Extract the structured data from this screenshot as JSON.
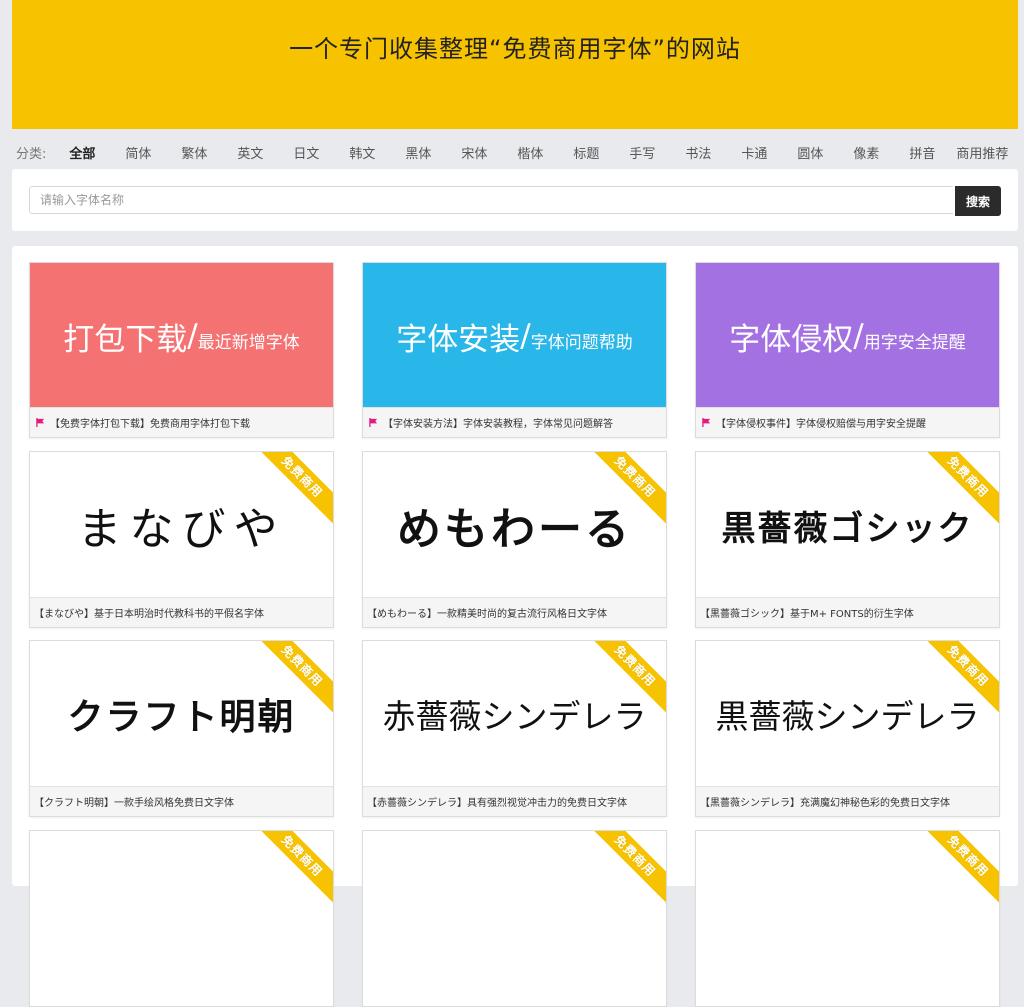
{
  "header": {
    "title": "一个专门收集整理“免费商用字体”的网站"
  },
  "categories": {
    "label": "分类:",
    "items": [
      "全部",
      "简体",
      "繁体",
      "英文",
      "日文",
      "韩文",
      "黑体",
      "宋体",
      "楷体",
      "标题",
      "手写",
      "书法",
      "卡通",
      "圆体",
      "像素",
      "拼音",
      "商用推荐"
    ]
  },
  "search": {
    "placeholder": "请输入字体名称",
    "button": "搜索"
  },
  "colors": {
    "banner": "#f7c200",
    "download": "#f57273",
    "install": "#29b6e8",
    "rights": "#a371e2",
    "flag": "#e5197f"
  },
  "features": [
    {
      "big": "打包下载",
      "slash": "/",
      "small": "最近新增字体",
      "caption": "【免费字体打包下载】免费商用字体打包下载",
      "icon": "flag-icon"
    },
    {
      "big": "字体安装",
      "slash": "/",
      "small": "字体问题帮助",
      "caption": "【字体安装方法】字体安装教程，字体常见问题解答",
      "icon": "flag-icon"
    },
    {
      "big": "字体侵权",
      "slash": "/",
      "small": "用字安全提醒",
      "caption": "【字体侵权事件】字体侵权赔偿与用字安全提醒",
      "icon": "flag-icon"
    }
  ],
  "fonts": [
    {
      "sample": "まなびや",
      "badge": "免费商用",
      "caption": "【まなびや】基于日本明治时代教科书的平假名字体"
    },
    {
      "sample": "めもわーる",
      "badge": "免费商用",
      "caption": "【めもわーる】一款精美时尚的复古流行风格日文字体"
    },
    {
      "sample": "黒薔薇ゴシック",
      "badge": "免费商用",
      "caption": "【黒薔薇ゴシック】基于M+ FONTS的衍生字体"
    },
    {
      "sample": "クラフト明朝",
      "badge": "免费商用",
      "caption": "【クラフト明朝】一款手绘风格免费日文字体"
    },
    {
      "sample": "赤薔薇シンデレラ",
      "badge": "免费商用",
      "caption": "【赤薔薇シンデレラ】具有强烈视觉冲击力的免费日文字体"
    },
    {
      "sample": "黒薔薇シンデレラ",
      "badge": "免费商用",
      "caption": "【黒薔薇シンデレラ】充满魔幻神秘色彩的免费日文字体"
    },
    {
      "sample": "",
      "badge": "免费商用",
      "caption": ""
    },
    {
      "sample": "",
      "badge": "免费商用",
      "caption": ""
    },
    {
      "sample": "",
      "badge": "免费商用",
      "caption": ""
    }
  ]
}
